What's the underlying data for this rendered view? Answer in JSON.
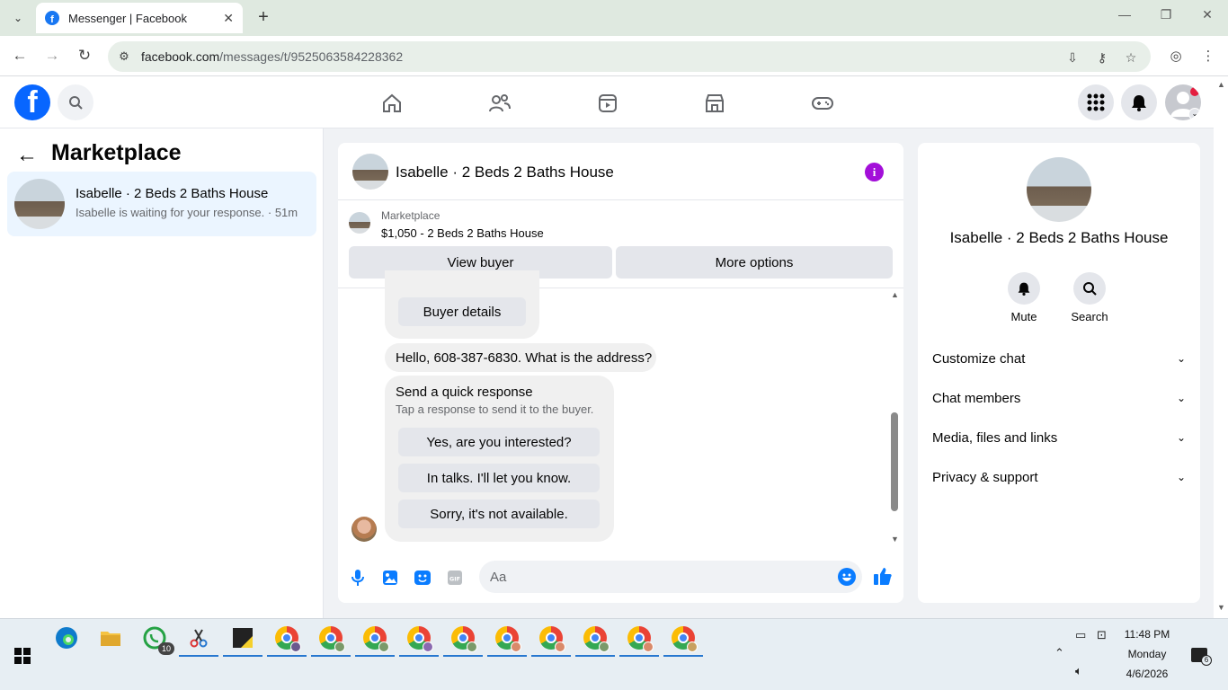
{
  "browser": {
    "tab_title": "Messenger | Facebook",
    "url_host": "facebook.com",
    "url_path": "/messages/t/9525063584228362"
  },
  "sidebar": {
    "title": "Marketplace",
    "conversations": [
      {
        "name": "Isabelle · 2 Beds 2 Baths House",
        "preview": "Isabelle is waiting for your response. · 51m"
      }
    ]
  },
  "chat": {
    "header_name": "Isabelle · 2 Beds 2 Baths House",
    "marketplace_label": "Marketplace",
    "listing": "$1,050 - 2 Beds 2 Baths House",
    "view_buyer": "View buyer",
    "more_options": "More options",
    "buyer_details": "Buyer details",
    "incoming_message": "Hello, 608-387-6830. What is the address?",
    "quick_response_title": "Send a quick response",
    "quick_response_sub": "Tap a response to send it to the buyer.",
    "quick_responses": [
      "Yes, are you interested?",
      "In talks. I'll let you know.",
      "Sorry, it's not available."
    ],
    "composer_placeholder": "Aa"
  },
  "info_panel": {
    "name": "Isabelle · 2 Beds 2 Baths House",
    "actions": [
      "Mute",
      "Search"
    ],
    "sections": [
      "Customize chat",
      "Chat members",
      "Media, files and links",
      "Privacy & support"
    ]
  },
  "taskbar": {
    "whatsapp_badge": "10",
    "time": "11:48 PM",
    "day": "Monday",
    "date": "4/6/2026",
    "notifications": "6"
  },
  "colors": {
    "facebook_blue": "#0866ff",
    "messenger_blue": "#0a7cff",
    "info_purple": "#a30fd9",
    "selected_conv_bg": "#ebf5ff"
  }
}
